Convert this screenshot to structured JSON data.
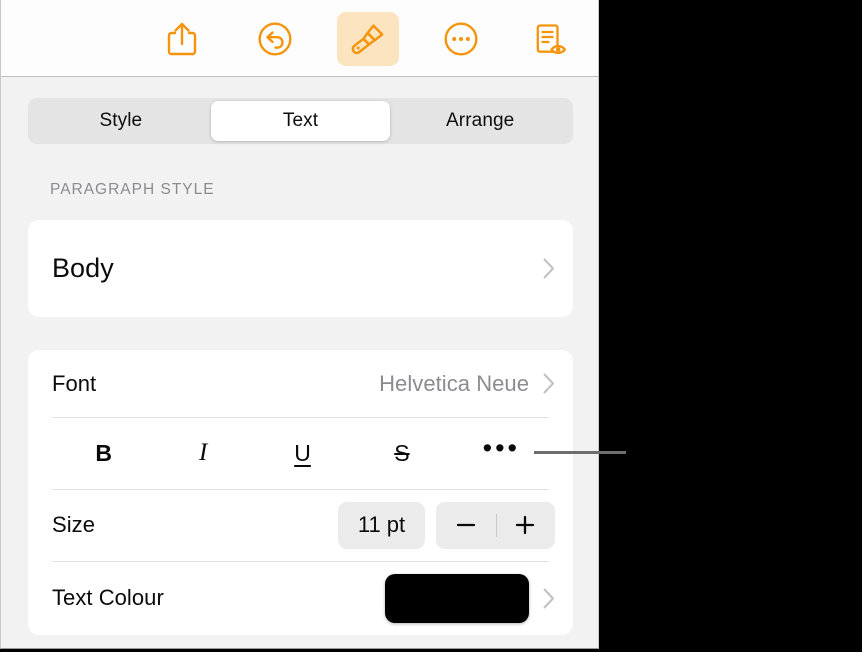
{
  "window": {
    "background_color": "#000000",
    "panel_background": "#f2f2f2",
    "accent_color": "#f5940b"
  },
  "toolbar": {
    "buttons": [
      {
        "name": "share-icon",
        "label": "Share",
        "active": false
      },
      {
        "name": "undo-icon",
        "label": "Undo",
        "active": false
      },
      {
        "name": "brush-icon",
        "label": "Format",
        "active": true
      },
      {
        "name": "more-icon",
        "label": "More",
        "active": false
      },
      {
        "name": "document-view-icon",
        "label": "Document",
        "active": false
      }
    ],
    "active_button_background": "#fce4c0"
  },
  "segmented_control": {
    "selected": "Text",
    "tabs": [
      {
        "label": "Style",
        "selected": false
      },
      {
        "label": "Text",
        "selected": true
      },
      {
        "label": "Arrange",
        "selected": false
      }
    ]
  },
  "paragraph_style": {
    "section_label": "PARAGRAPH STYLE",
    "value": "Body",
    "disclosure_icon": "chevron-right-icon"
  },
  "font_row": {
    "label": "Font",
    "value": "Helvetica Neue",
    "disclosure_icon": "chevron-right-icon"
  },
  "format_row": {
    "buttons": [
      {
        "name": "bold-button",
        "glyph": "B"
      },
      {
        "name": "italic-button",
        "glyph": "I"
      },
      {
        "name": "underline-button",
        "glyph": "U"
      },
      {
        "name": "strikethrough-button",
        "glyph": "S"
      },
      {
        "name": "more-format-button",
        "glyph": "•••"
      }
    ]
  },
  "size_row": {
    "label": "Size",
    "value": "11 pt",
    "decrease_glyph": "−",
    "increase_glyph": "+"
  },
  "colour_row": {
    "label": "Text Colour",
    "swatch_color": "#000000",
    "disclosure_icon": "chevron-right-icon"
  },
  "callout": {
    "name": "callout-leader-line",
    "color": "#6e6e6e"
  }
}
